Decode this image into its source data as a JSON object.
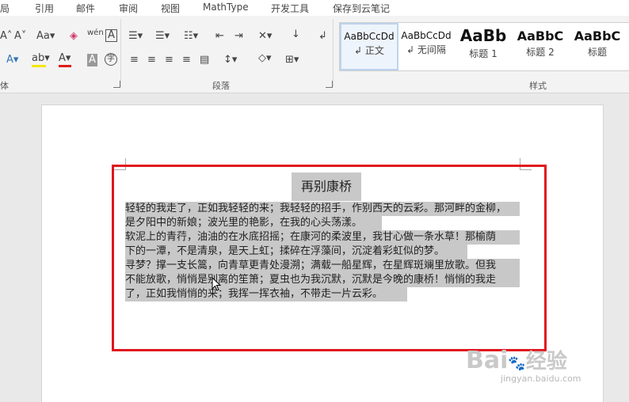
{
  "tabs": {
    "layout_partial": "局",
    "references": "引用",
    "mailings": "邮件",
    "review": "审阅",
    "view": "视图",
    "mathtype": "MathType",
    "developer": "开发工具",
    "save_cloud": "保存到云笔记"
  },
  "ribbon": {
    "font_group_partial": "体",
    "paragraph_group": "段落",
    "styles_group": "样式",
    "font_size_symbol": "A",
    "change_case": "Aa",
    "phonetic": "wén",
    "char_border": "A",
    "font_color": "A",
    "text_effects": "A",
    "char_shading": "A",
    "enclose_char": "字"
  },
  "styles": [
    {
      "preview": "AaBbCcDd",
      "name": "正文",
      "selected": true
    },
    {
      "preview": "AaBbCcDd",
      "name": "无间隔",
      "selected": false
    },
    {
      "preview": "AaBb",
      "name": "标题 1",
      "selected": false
    },
    {
      "preview": "AaBbC",
      "name": "标题 2",
      "selected": false
    },
    {
      "preview": "AaBbC",
      "name": "标题",
      "selected": false
    }
  ],
  "document": {
    "title": "再别康桥",
    "lines": [
      "轻轻的我走了，正如我轻轻的来；我轻轻的招手，作别西天的云彩。那河畔的金柳，",
      "是夕阳中的新娘；波光里的艳影，在我的心头荡漾。",
      "软泥上的青荇，油油的在水底招摇；在康河的柔波里，我甘心做一条水草！那榆荫",
      "下的一潭，不是清泉，是天上虹；揉碎在浮藻间，沉淀着彩虹似的梦。",
      "寻梦？撑一支长篙，向青草更青处漫溯；满载一船星辉，在星辉斑斓里放歌。但我",
      "不能放歌，悄悄是别离的笙箫；夏虫也为我沉默，沉默是今晚的康桥！悄悄的我走",
      "了，正如我悄悄的来；我挥一挥衣袖，不带走一片云彩。"
    ]
  },
  "watermark": {
    "brand": "Bai",
    "brand_cn": "经验",
    "url": "jingyan.baidu.com"
  },
  "colors": {
    "highlight": "#c8c8c8",
    "red_box": "#e0171d",
    "font_color_bar": "#e01a1a",
    "highlight_bar": "#f5e600"
  }
}
